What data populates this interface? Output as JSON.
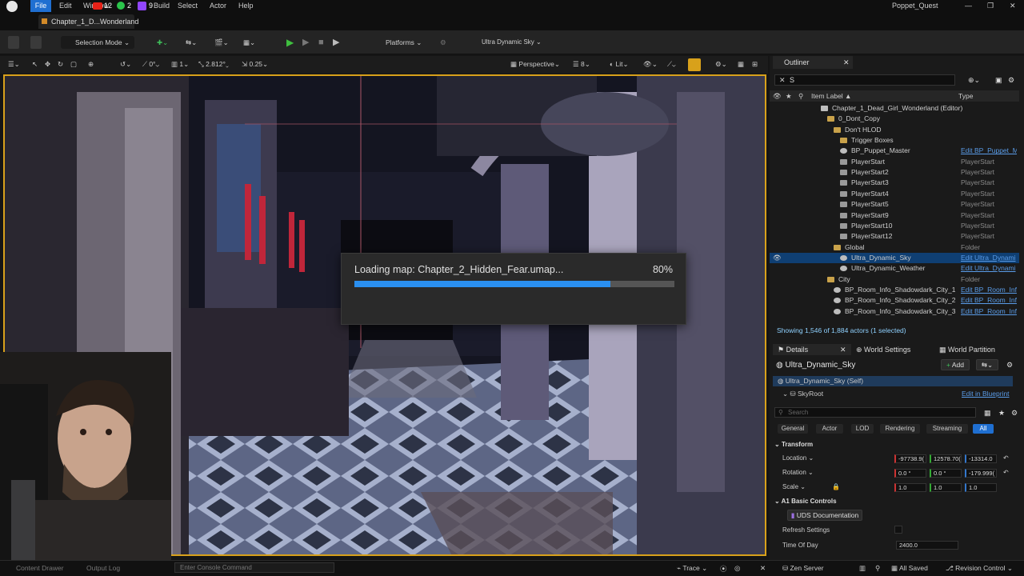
{
  "menu": {
    "file": "File",
    "edit": "Edit",
    "window": "Window",
    "build": "Build",
    "select": "Select",
    "actor": "Actor",
    "help": "Help",
    "badges": [
      "12",
      "2",
      "9"
    ]
  },
  "project_name": "Poppet_Quest",
  "level_tab": "Chapter_1_D...Wonderland",
  "toolbar": {
    "selection_mode": "Selection Mode",
    "platforms": "Platforms",
    "sky": "Ultra Dynamic Sky"
  },
  "viewport_toolbar": {
    "rot_snap": "0°",
    "scale_num": "1",
    "cam_speed": "2.812°",
    "scale_snap": "0.25",
    "perspective": "Perspective",
    "fov": "8",
    "lit": "Lit"
  },
  "loading": {
    "text": "Loading map: Chapter_2_Hidden_Fear.umap...",
    "percent_label": "80%",
    "progress": 0.8
  },
  "status": {
    "console_placeholder": "Enter Console Command",
    "content_drawer": "Content Drawer",
    "output_log": "Output Log",
    "trace": "Trace",
    "zen_server": "Zen Server",
    "all_saved": "All Saved",
    "revision_control": "Revision Control"
  },
  "outliner": {
    "title": "Outliner",
    "search": "S",
    "col_label": "Item Label ▲",
    "col_type": "Type",
    "rows": [
      {
        "label": "Chapter_1_Dead_Girl_Wonderland (Editor)",
        "type": "",
        "indent": 78,
        "icon": "level-icon"
      },
      {
        "label": "0_Dont_Copy",
        "type": "",
        "indent": 86,
        "icon": "folder-icon"
      },
      {
        "label": "Don't HLOD",
        "type": "",
        "indent": 94,
        "icon": "folder-icon"
      },
      {
        "label": "Trigger Boxes",
        "type": "",
        "indent": 102,
        "icon": "folder-icon"
      },
      {
        "label": "BP_Puppet_Master",
        "type": "Edit BP_Puppet_M",
        "indent": 102,
        "icon": "actor-icon",
        "link": true
      },
      {
        "label": "PlayerStart",
        "type": "PlayerStart",
        "indent": 102,
        "icon": "playerstart-icon"
      },
      {
        "label": "PlayerStart2",
        "type": "PlayerStart",
        "indent": 102,
        "icon": "playerstart-icon"
      },
      {
        "label": "PlayerStart3",
        "type": "PlayerStart",
        "indent": 102,
        "icon": "playerstart-icon"
      },
      {
        "label": "PlayerStart4",
        "type": "PlayerStart",
        "indent": 102,
        "icon": "playerstart-icon"
      },
      {
        "label": "PlayerStart5",
        "type": "PlayerStart",
        "indent": 102,
        "icon": "playerstart-icon"
      },
      {
        "label": "PlayerStart9",
        "type": "PlayerStart",
        "indent": 102,
        "icon": "playerstart-icon"
      },
      {
        "label": "PlayerStart10",
        "type": "PlayerStart",
        "indent": 102,
        "icon": "playerstart-icon"
      },
      {
        "label": "PlayerStart12",
        "type": "PlayerStart",
        "indent": 102,
        "icon": "playerstart-icon"
      },
      {
        "label": "Global",
        "type": "Folder",
        "indent": 94,
        "icon": "folder-icon"
      },
      {
        "label": "Ultra_Dynamic_Sky",
        "type": "Edit Ultra_Dynami",
        "indent": 102,
        "icon": "actor-icon",
        "link": true,
        "selected": true
      },
      {
        "label": "Ultra_Dynamic_Weather",
        "type": "Edit Ultra_Dynami",
        "indent": 102,
        "icon": "actor-icon",
        "link": true
      },
      {
        "label": "City",
        "type": "Folder",
        "indent": 86,
        "icon": "folder-icon"
      },
      {
        "label": "BP_Room_Info_Shadowdark_City_1",
        "type": "Edit BP_Room_Inf",
        "indent": 94,
        "icon": "actor-icon",
        "link": true
      },
      {
        "label": "BP_Room_Info_Shadowdark_City_2",
        "type": "Edit BP_Room_Inf",
        "indent": 94,
        "icon": "actor-icon",
        "link": true
      },
      {
        "label": "BP_Room_Info_Shadowdark_City_3",
        "type": "Edit BP_Room_Inf",
        "indent": 94,
        "icon": "actor-icon",
        "link": true
      }
    ],
    "showing": "Showing 1,546 of 1,884 actors (1 selected)"
  },
  "details": {
    "tabs": [
      "Details",
      "World Settings",
      "World Partition"
    ],
    "actor_name": "Ultra_Dynamic_Sky",
    "add": "Add",
    "self": "Ultra_Dynamic_Sky (Self)",
    "skyroot": "SkyRoot",
    "edit_bp": "Edit in Blueprint",
    "search_placeholder": "Search",
    "categories": [
      "General",
      "Actor",
      "LOD",
      "Rendering",
      "Streaming",
      "All"
    ],
    "transform": "Transform",
    "location": "Location",
    "rotation": "Rotation",
    "scale": "Scale",
    "loc": [
      "-97738.9(",
      "12578.70(",
      "-13314.0"
    ],
    "rot": [
      "0.0 °",
      "0.0 °",
      "-179.999("
    ],
    "scl": [
      "1.0",
      "1.0",
      "1.0"
    ],
    "basic_controls": "Basic Controls",
    "uds_doc": "UDS Documentation",
    "refresh": "Refresh Settings",
    "time_of_day": "Time Of Day",
    "time_value": "2400.0"
  },
  "colors": {
    "accent": "#d8a11b",
    "progress": "#2a8ff0",
    "selection": "#0f3f73",
    "highlight": "#3ccf3c"
  }
}
